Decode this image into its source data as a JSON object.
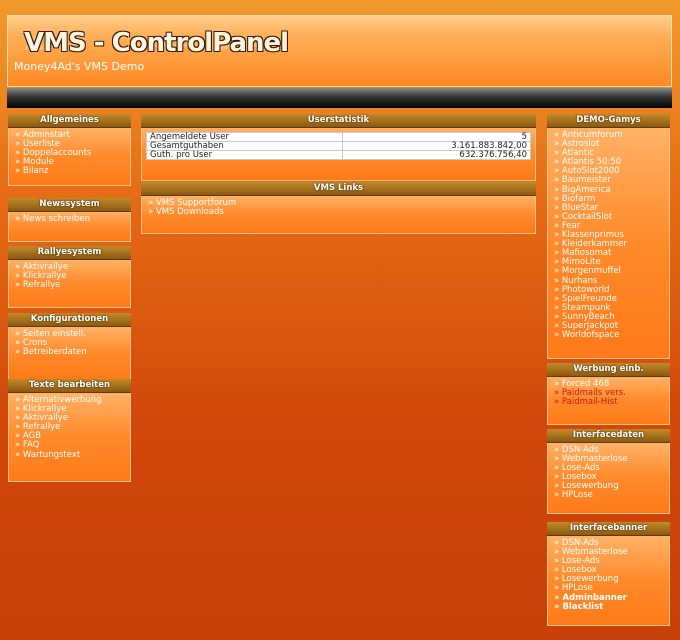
{
  "header": {
    "title": "VMS - ControlPanel",
    "subtitle": "Money4Ad's VMS Demo"
  },
  "left": {
    "allgemeines": {
      "title": "Allgemeines",
      "items": [
        "Adminstart",
        "Userliste",
        "Doppelaccounts",
        "Module",
        "Bilanz"
      ]
    },
    "newssystem": {
      "title": "Newssystem",
      "items": [
        "News schreiben"
      ]
    },
    "rallyesystem": {
      "title": "Rallyesystem",
      "items": [
        "Aktivrallye",
        "Klickrallye",
        "Refrallye"
      ]
    },
    "konfigurationen": {
      "title": "Konfigurationen",
      "items": [
        "Seiten einstell.",
        "Crons",
        "Betreiberdaten"
      ]
    },
    "texte": {
      "title": "Texte bearbeiten",
      "items": [
        "Alternativwerbung",
        "Klickrallye",
        "Aktivrallye",
        "Refrallye",
        "AGB",
        "FAQ",
        "Wartungstext"
      ]
    }
  },
  "center": {
    "userstatistik": {
      "title": "Userstatistik",
      "rows": [
        {
          "label": "Angemeldete User",
          "value": "5"
        },
        {
          "label": "Gesamtguthaben",
          "value": "3.161.883.842,00"
        },
        {
          "label": "Guth. pro User",
          "value": "632.376.756,40"
        }
      ]
    },
    "links": {
      "title": "VMS Links",
      "items": [
        "VMS Supportforum",
        "VMS Downloads"
      ]
    }
  },
  "right": {
    "demo": {
      "title": "DEMO-Gamys",
      "items": [
        "Anticumforum",
        "Astroslot",
        "Atlantic",
        "Atlantis 50:50",
        "AutoSlot2000",
        "Baumeister",
        "BigAmerica",
        "Biofarm",
        "BlueStar",
        "CocktailSlot",
        "Fear",
        "Klassenprimus",
        "Kleiderkammer",
        "Mafiosomat",
        "MimoLite",
        "Morgenmuffel",
        "Nurhans",
        "Photoworld",
        "SpielFreunde",
        "Steampunk",
        "SunnyBeach",
        "SuperJackpot",
        "Worldofspace"
      ]
    },
    "werbung": {
      "title": "Werbung einb.",
      "items": [
        {
          "label": "Forced 468",
          "style": ""
        },
        {
          "label": "Paidmails vers.",
          "style": "red"
        },
        {
          "label": "Paidmail-Hist",
          "style": "red"
        }
      ]
    },
    "interfacedaten": {
      "title": "Interfacedaten",
      "items": [
        "DSN-Ads",
        "Webmasterlose",
        "Lose-Ads",
        "Losebox",
        "Losewerbung",
        "HPLose"
      ]
    },
    "interfacebanner": {
      "title": "Interfacebanner",
      "items": [
        {
          "label": "DSN-Ads",
          "style": ""
        },
        {
          "label": "Webmasterlose",
          "style": ""
        },
        {
          "label": "Lose-Ads",
          "style": ""
        },
        {
          "label": "Losebox",
          "style": ""
        },
        {
          "label": "Losewerbung",
          "style": ""
        },
        {
          "label": "HPLose",
          "style": ""
        },
        {
          "label": "Adminbanner",
          "style": "bold"
        },
        {
          "label": "Blacklist",
          "style": "bold"
        }
      ]
    }
  },
  "colors": {
    "background_top": "#f39a2c",
    "background_bottom": "#c8400a",
    "box_header": "#8b5a10",
    "link_red": "#d8140a"
  }
}
